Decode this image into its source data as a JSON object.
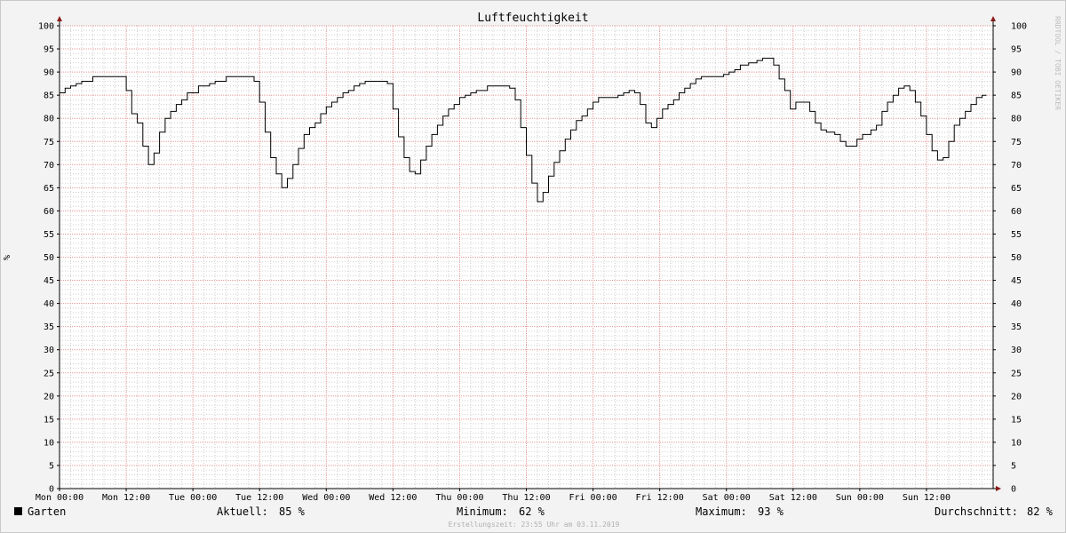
{
  "chart_data": {
    "type": "line",
    "title": "Luftfeuchtigkeit",
    "ylabel": "%",
    "ylim": [
      0,
      100
    ],
    "y_ticks": [
      0,
      5,
      10,
      15,
      20,
      25,
      30,
      35,
      40,
      45,
      50,
      55,
      60,
      65,
      70,
      75,
      80,
      85,
      90,
      95,
      100
    ],
    "x_range_hours": [
      0,
      168
    ],
    "x_ticks": [
      {
        "hour": 0,
        "label": "Mon 00:00"
      },
      {
        "hour": 12,
        "label": "Mon 12:00"
      },
      {
        "hour": 24,
        "label": "Tue 00:00"
      },
      {
        "hour": 36,
        "label": "Tue 12:00"
      },
      {
        "hour": 48,
        "label": "Wed 00:00"
      },
      {
        "hour": 60,
        "label": "Wed 12:00"
      },
      {
        "hour": 72,
        "label": "Thu 00:00"
      },
      {
        "hour": 84,
        "label": "Thu 12:00"
      },
      {
        "hour": 96,
        "label": "Fri 00:00"
      },
      {
        "hour": 108,
        "label": "Fri 12:00"
      },
      {
        "hour": 120,
        "label": "Sat 00:00"
      },
      {
        "hour": 132,
        "label": "Sat 12:00"
      },
      {
        "hour": 144,
        "label": "Sun 00:00"
      },
      {
        "hour": 156,
        "label": "Sun 12:00"
      }
    ],
    "grid": true,
    "series": [
      {
        "name": "Garten",
        "color": "#000000",
        "points": [
          [
            0,
            85.5
          ],
          [
            1,
            86.5
          ],
          [
            2,
            87
          ],
          [
            3,
            87.5
          ],
          [
            4,
            88
          ],
          [
            6,
            89
          ],
          [
            7.5,
            89
          ],
          [
            10,
            89
          ],
          [
            11.5,
            89
          ],
          [
            12,
            86
          ],
          [
            13,
            81
          ],
          [
            14,
            79
          ],
          [
            15,
            74
          ],
          [
            16,
            70
          ],
          [
            17,
            72.5
          ],
          [
            18,
            77
          ],
          [
            19,
            80
          ],
          [
            20,
            81.5
          ],
          [
            21,
            83
          ],
          [
            22,
            84
          ],
          [
            23,
            85.5
          ],
          [
            25,
            87
          ],
          [
            27,
            87.5
          ],
          [
            28,
            88
          ],
          [
            30,
            89
          ],
          [
            33,
            89
          ],
          [
            35,
            88
          ],
          [
            36,
            83.5
          ],
          [
            37,
            77
          ],
          [
            38,
            71.5
          ],
          [
            39,
            68
          ],
          [
            40,
            65
          ],
          [
            41,
            67
          ],
          [
            42,
            70
          ],
          [
            43,
            73.5
          ],
          [
            44,
            76.5
          ],
          [
            45,
            78
          ],
          [
            46,
            79
          ],
          [
            47,
            81
          ],
          [
            48,
            82.5
          ],
          [
            49,
            83.5
          ],
          [
            50,
            84.5
          ],
          [
            51,
            85.5
          ],
          [
            52,
            86
          ],
          [
            53,
            87
          ],
          [
            54,
            87.5
          ],
          [
            55,
            88
          ],
          [
            57.5,
            88
          ],
          [
            59,
            87.5
          ],
          [
            60,
            82
          ],
          [
            61,
            76
          ],
          [
            62,
            71.5
          ],
          [
            63,
            68.5
          ],
          [
            64,
            68
          ],
          [
            65,
            71
          ],
          [
            66,
            74
          ],
          [
            67,
            76.5
          ],
          [
            68,
            78.5
          ],
          [
            69,
            80.5
          ],
          [
            70,
            82
          ],
          [
            71,
            83
          ],
          [
            72,
            84.5
          ],
          [
            73,
            85
          ],
          [
            74,
            85.5
          ],
          [
            75,
            86
          ],
          [
            77,
            87
          ],
          [
            80,
            87
          ],
          [
            81,
            86.5
          ],
          [
            82,
            84
          ],
          [
            83,
            78
          ],
          [
            84,
            72
          ],
          [
            85,
            66
          ],
          [
            86,
            62
          ],
          [
            87,
            64
          ],
          [
            88,
            67.5
          ],
          [
            89,
            70.5
          ],
          [
            90,
            73
          ],
          [
            91,
            75.5
          ],
          [
            92,
            77.5
          ],
          [
            93,
            79.5
          ],
          [
            94,
            80.5
          ],
          [
            95,
            82
          ],
          [
            96,
            83.5
          ],
          [
            97,
            84.5
          ],
          [
            100.5,
            85
          ],
          [
            101.5,
            85.5
          ],
          [
            102.5,
            86
          ],
          [
            103.5,
            85.5
          ],
          [
            104.5,
            83
          ],
          [
            105.5,
            79
          ],
          [
            106.5,
            78
          ],
          [
            107.5,
            80
          ],
          [
            108.5,
            82
          ],
          [
            109.5,
            83
          ],
          [
            110.5,
            84
          ],
          [
            111.5,
            85.5
          ],
          [
            112.5,
            86.5
          ],
          [
            113.5,
            87.5
          ],
          [
            114.5,
            88.5
          ],
          [
            115.5,
            89
          ],
          [
            118,
            89
          ],
          [
            119.5,
            89.5
          ],
          [
            120.5,
            90
          ],
          [
            121.5,
            90.5
          ],
          [
            122.5,
            91.5
          ],
          [
            124,
            92
          ],
          [
            125.5,
            92.5
          ],
          [
            126.5,
            93
          ],
          [
            128,
            93
          ],
          [
            128.5,
            91.5
          ],
          [
            129.5,
            88.5
          ],
          [
            130.5,
            86
          ],
          [
            131.5,
            82
          ],
          [
            132.5,
            83.5
          ],
          [
            134,
            83.5
          ],
          [
            135,
            81.5
          ],
          [
            136,
            79
          ],
          [
            137,
            77.5
          ],
          [
            138,
            77
          ],
          [
            139.5,
            76.5
          ],
          [
            140.5,
            75
          ],
          [
            141.5,
            74
          ],
          [
            143,
            74
          ],
          [
            143.5,
            75.5
          ],
          [
            144.5,
            76.5
          ],
          [
            146,
            77.5
          ],
          [
            147,
            78.5
          ],
          [
            148,
            81.5
          ],
          [
            149,
            83.5
          ],
          [
            150,
            85
          ],
          [
            151,
            86.5
          ],
          [
            152,
            87
          ],
          [
            153,
            86
          ],
          [
            154,
            83.5
          ],
          [
            155,
            80.5
          ],
          [
            156,
            76.5
          ],
          [
            157,
            73
          ],
          [
            158,
            71
          ],
          [
            159,
            71.5
          ],
          [
            160,
            75
          ],
          [
            161,
            78.5
          ],
          [
            162,
            80
          ],
          [
            163,
            81.5
          ],
          [
            164,
            83
          ],
          [
            165,
            84.5
          ],
          [
            166,
            85
          ],
          [
            166.8,
            85
          ]
        ]
      }
    ]
  },
  "legend": {
    "series_name": "Garten",
    "swatch_color": "#000000",
    "current_label": "Aktuell:",
    "current_value": "85 %",
    "min_label": "Minimum:",
    "min_value": "62 %",
    "max_label": "Maximum:",
    "max_value": "93 %",
    "avg_label": "Durchschnitt:",
    "avg_value": "82 %"
  },
  "watermark": "RRDTOOL / TOBI OETIKER",
  "footer": "Erstellungszeit: 23:55 Uhr am 03.11.2019",
  "colors": {
    "background": "#f3f3f3",
    "plot_background": "#ffffff",
    "major_grid": "#e59a9a",
    "minor_grid": "#cfcfcf",
    "axis_arrow": "#8b1a1a",
    "line": "#000000"
  }
}
